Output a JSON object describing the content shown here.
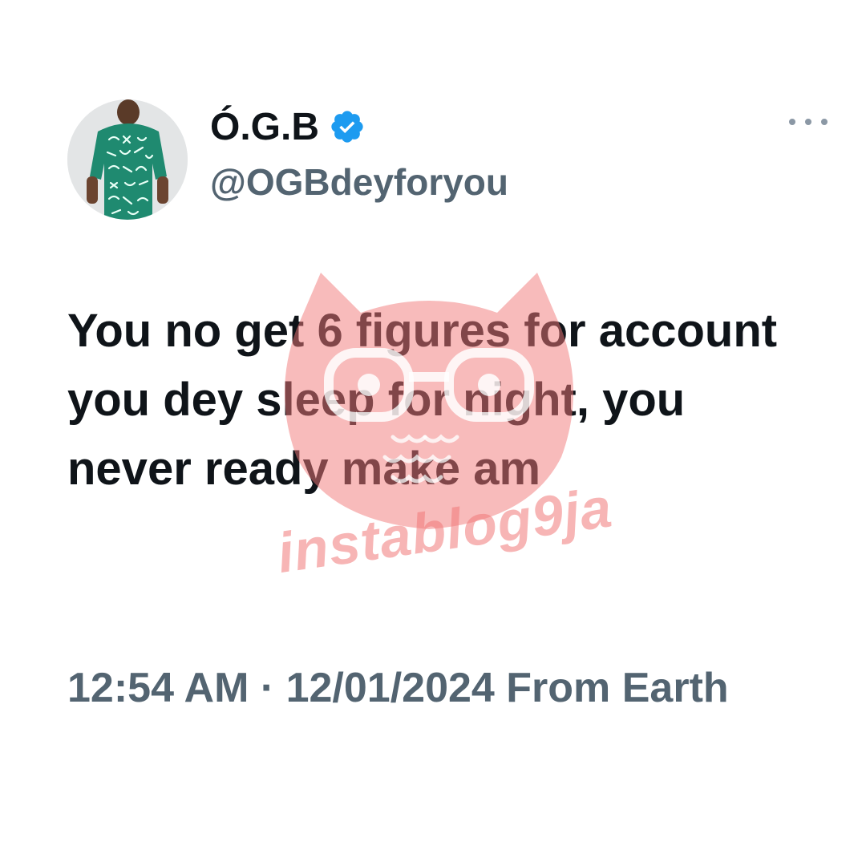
{
  "tweet": {
    "author": {
      "display_name": "Ó.G.B",
      "handle": "@OGBdeyforyou",
      "verified": true,
      "verified_color": "#1d9bf0",
      "avatar_icon": "profile-photo"
    },
    "more_icon": "more-horizontal-icon",
    "text": "You no get 6 figures for account you dey sleep for night, you never ready make am",
    "timestamp": "12:54 AM · 12/01/2024 From Earth"
  },
  "watermark": {
    "text": "instablog9ja",
    "icon": "owl-logo",
    "color": "#f07878"
  },
  "colors": {
    "text_primary": "#0f1419",
    "text_secondary": "#536471",
    "background": "#ffffff"
  }
}
